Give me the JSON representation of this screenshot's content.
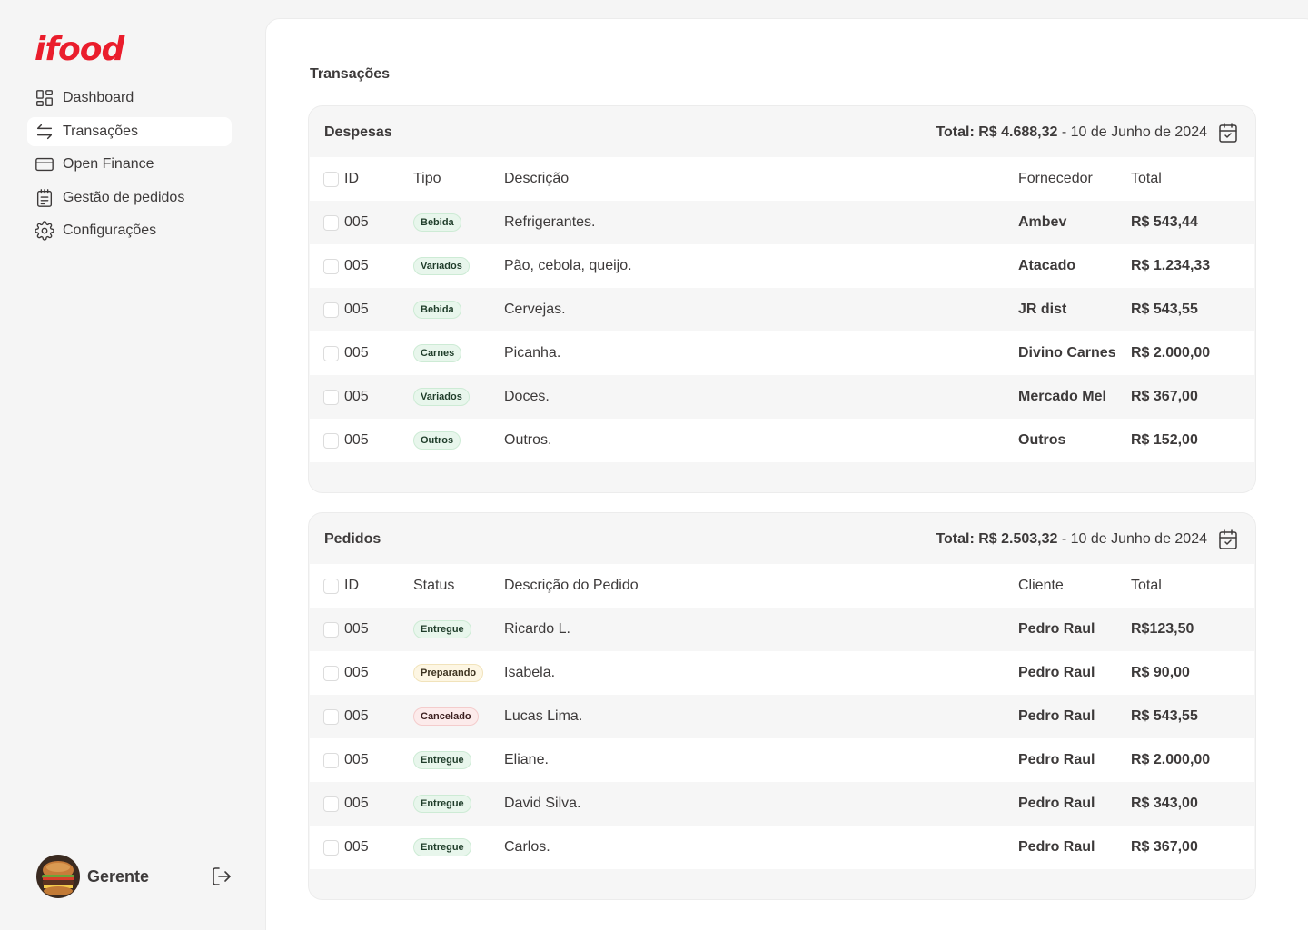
{
  "brand": {
    "logo_text": "ifood",
    "accent_color": "#ea1d2c"
  },
  "sidebar": {
    "items": [
      {
        "label": "Dashboard",
        "icon": "grid-icon",
        "active": false
      },
      {
        "label": "Transações",
        "icon": "arrows-swap-icon",
        "active": true
      },
      {
        "label": "Open Finance",
        "icon": "card-icon",
        "active": false
      },
      {
        "label": "Gestão de pedidos",
        "icon": "clipboard-icon",
        "active": false
      },
      {
        "label": "Configurações",
        "icon": "gear-icon",
        "active": false
      }
    ],
    "user": {
      "name": "Gerente",
      "avatar": "burger-avatar",
      "logout_icon": "logout-icon"
    }
  },
  "main": {
    "title": "Transações",
    "expenses": {
      "title": "Despesas",
      "total_label": "Total: R$ 4.688,32",
      "date": " - 10 de Junho de 2024",
      "columns": {
        "id": "ID",
        "tag": "Tipo",
        "desc": "Descrição",
        "party": "Fornecedor",
        "total": "Total"
      },
      "rows": [
        {
          "id": "005",
          "tag": "Bebida",
          "tag_color": "green",
          "desc": "Refrigerantes.",
          "party": "Ambev",
          "total": "R$ 543,44"
        },
        {
          "id": "005",
          "tag": "Variados",
          "tag_color": "green",
          "desc": "Pão, cebola, queijo.",
          "party": "Atacado",
          "total": "R$ 1.234,33"
        },
        {
          "id": "005",
          "tag": "Bebida",
          "tag_color": "green",
          "desc": "Cervejas.",
          "party": "JR dist",
          "total": "R$ 543,55"
        },
        {
          "id": "005",
          "tag": "Carnes",
          "tag_color": "green",
          "desc": "Picanha.",
          "party": "Divino Carnes",
          "total": "R$ 2.000,00"
        },
        {
          "id": "005",
          "tag": "Variados",
          "tag_color": "green",
          "desc": "Doces.",
          "party": "Mercado  Mel",
          "total": "R$ 367,00"
        },
        {
          "id": "005",
          "tag": "Outros",
          "tag_color": "green",
          "desc": "Outros.",
          "party": "Outros",
          "total": "R$ 152,00"
        }
      ]
    },
    "orders": {
      "title": "Pedidos",
      "total_label": "Total: R$ 2.503,32",
      "date": " - 10 de Junho de 2024",
      "columns": {
        "id": "ID",
        "tag": "Status",
        "desc": "Descrição do Pedido",
        "party": "Cliente",
        "total": "Total"
      },
      "rows": [
        {
          "id": "005",
          "tag": "Entregue",
          "tag_color": "green",
          "desc": "Ricardo L.",
          "party": "Pedro Raul",
          "total": "R$123,50"
        },
        {
          "id": "005",
          "tag": "Preparando",
          "tag_color": "yellow",
          "desc": "Isabela.",
          "party": "Pedro Raul",
          "total": "R$ 90,00"
        },
        {
          "id": "005",
          "tag": "Cancelado",
          "tag_color": "red",
          "desc": "Lucas Lima.",
          "party": "Pedro Raul",
          "total": "R$ 543,55"
        },
        {
          "id": "005",
          "tag": "Entregue",
          "tag_color": "green",
          "desc": "Eliane.",
          "party": "Pedro Raul",
          "total": "R$ 2.000,00"
        },
        {
          "id": "005",
          "tag": "Entregue",
          "tag_color": "green",
          "desc": "David Silva.",
          "party": "Pedro Raul",
          "total": "R$ 343,00"
        },
        {
          "id": "005",
          "tag": "Entregue",
          "tag_color": "green",
          "desc": "Carlos.",
          "party": "Pedro Raul",
          "total": "R$ 367,00"
        }
      ]
    }
  }
}
